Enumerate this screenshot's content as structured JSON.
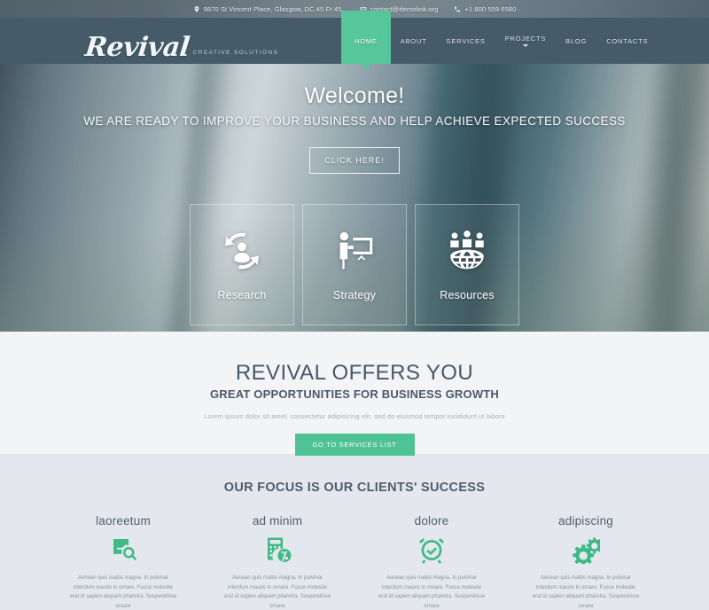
{
  "topbar": {
    "address": "9870 St Vincent Place, Glasgow, DC 45 Fr 45.",
    "email": "contact@demolink.org",
    "phone": "+1 800 559 6580",
    "icons": {
      "address": "map-pin-icon",
      "email": "envelope-icon",
      "phone": "phone-icon"
    }
  },
  "header": {
    "logo_name": "Revival",
    "logo_tagline": "CREATIVE SOLUTIONS",
    "nav": [
      {
        "label": "HOME",
        "active": true,
        "dropdown": false
      },
      {
        "label": "ABOUT",
        "active": false,
        "dropdown": false
      },
      {
        "label": "SERVICES",
        "active": false,
        "dropdown": false
      },
      {
        "label": "PROJECTS",
        "active": false,
        "dropdown": true
      },
      {
        "label": "BLOG",
        "active": false,
        "dropdown": false
      },
      {
        "label": "CONTACTS",
        "active": false,
        "dropdown": false
      }
    ]
  },
  "hero": {
    "title": "Welcome!",
    "subtitle": "WE ARE READY TO IMPROVE YOUR BUSINESS AND HELP ACHIEVE EXPECTED SUCCESS",
    "button": "CLICK HERE!",
    "boxes": [
      {
        "label": "Research",
        "icon": "people-cycle-icon"
      },
      {
        "label": "Strategy",
        "icon": "presenter-board-icon"
      },
      {
        "label": "Resources",
        "icon": "globe-people-icon"
      }
    ]
  },
  "offers": {
    "heading": "REVIVAL OFFERS YOU",
    "subheading": "GREAT OPPORTUNITIES FOR BUSINESS GROWTH",
    "paragraph": "Lorem ipsum dolor sit amet, consectetur adipisicing elit, sed do eiusmod tempor incididunt ut labore",
    "button": "GO TO SERVICES LIST"
  },
  "focus": {
    "heading": "OUR FOCUS IS OUR CLIENTS' SUCCESS",
    "columns": [
      {
        "title": "laoreetum",
        "icon": "book-search-icon",
        "text": "Aenean quis mattis magna. In pulvinar interdum mauris in ornare. Fusce molestie erat id sapien aliquam pharetra. Suspendisse ornare"
      },
      {
        "title": "ad minim",
        "icon": "calculator-percent-icon",
        "text": "Aenean quis mattis magna. In pulvinar interdum mauris in ornare. Fusce molestie erat id sapien aliquam pharetra. Suspendisse ornare"
      },
      {
        "title": "dolore",
        "icon": "alarm-clock-icon",
        "text": "Aenean quis mattis magna. In pulvinar interdum mauris in ornare. Fusce molestie erat id sapien aliquam pharetra. Suspendisse ornare"
      },
      {
        "title": "adipiscing",
        "icon": "gears-icon",
        "text": "Aenean quis mattis magna. In pulvinar interdum mauris in ornare. Fusce molestie erat id sapien aliquam pharetra. Suspendisse ornare"
      }
    ]
  },
  "colors": {
    "header_bg": "#455b69",
    "accent_green": "#57c69a",
    "button_green": "#4fc395",
    "icon_green": "#3fba86",
    "offers_bg": "#f3f4f6",
    "focus_bg": "#e4e8ee",
    "heading_text": "#46586a"
  }
}
